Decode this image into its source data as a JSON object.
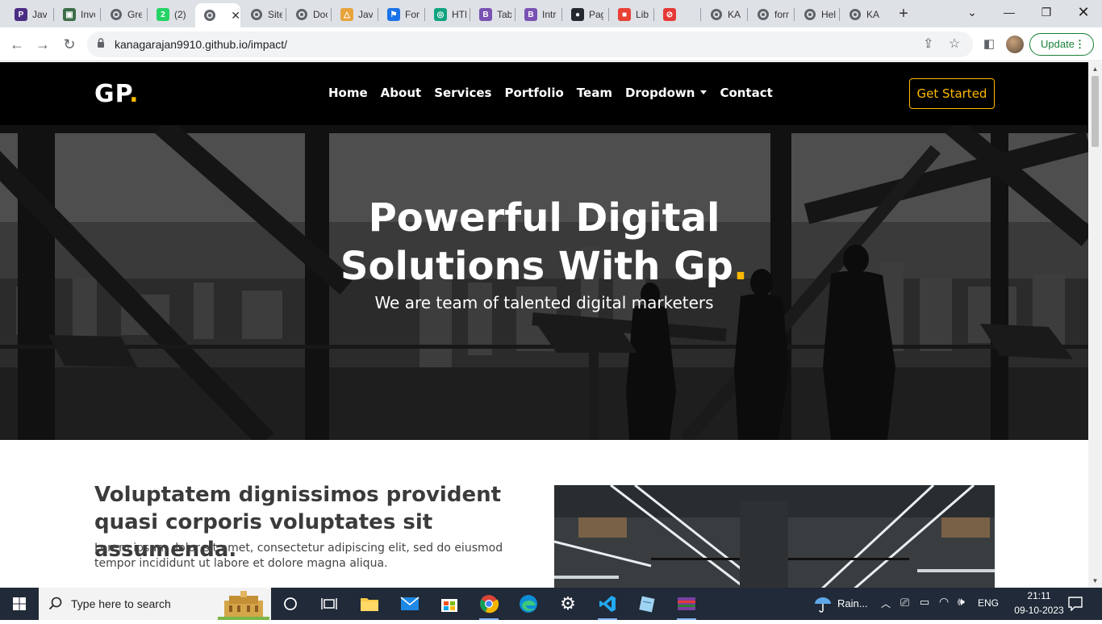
{
  "browser": {
    "tabs": [
      {
        "title": "Java",
        "favicon_color": "#4b2e83",
        "favicon": "P"
      },
      {
        "title": "Invoice",
        "favicon_color": "#3c6e47",
        "favicon": "▣"
      },
      {
        "title": "Great",
        "favicon_color": "#5f6368",
        "favicon": "globe"
      },
      {
        "title": "(2)",
        "favicon_color": "#25d366",
        "favicon": "2"
      },
      {
        "title": "",
        "favicon_color": "#5f6368",
        "favicon": "globe",
        "active": true
      },
      {
        "title": "Site",
        "favicon_color": "#5f6368",
        "favicon": "globe"
      },
      {
        "title": "Doc",
        "favicon_color": "#5f6368",
        "favicon": "globe"
      },
      {
        "title": "Java",
        "favicon_color": "#e8a33d",
        "favicon": "△"
      },
      {
        "title": "For",
        "favicon_color": "#1a73e8",
        "favicon": "⚑"
      },
      {
        "title": "HTML",
        "favicon_color": "#10a37f",
        "favicon": "◎"
      },
      {
        "title": "Tab",
        "favicon_color": "#7952b3",
        "favicon": "B"
      },
      {
        "title": "Intro",
        "favicon_color": "#7952b3",
        "favicon": "B"
      },
      {
        "title": "Pag",
        "favicon_color": "#24292f",
        "favicon": "●"
      },
      {
        "title": "Lib",
        "favicon_color": "#e94235",
        "favicon": "■"
      },
      {
        "title": "",
        "favicon_color": "#e53935",
        "favicon": "⊘"
      },
      {
        "title": "KA",
        "favicon_color": "#5f6368",
        "favicon": "globe"
      },
      {
        "title": "form",
        "favicon_color": "#5f6368",
        "favicon": "globe"
      },
      {
        "title": "Hel",
        "favicon_color": "#5f6368",
        "favicon": "globe"
      },
      {
        "title": "KA",
        "favicon_color": "#5f6368",
        "favicon": "globe"
      }
    ],
    "new_tab_icon": "plus-icon",
    "url": "kanagarajan9910.github.io/impact/",
    "update_label": "Update"
  },
  "site": {
    "logo_text": "GP",
    "logo_dot": ".",
    "nav": [
      {
        "label": "Home"
      },
      {
        "label": "About"
      },
      {
        "label": "Services"
      },
      {
        "label": "Portfolio"
      },
      {
        "label": "Team"
      },
      {
        "label": "Dropdown",
        "has_caret": true
      },
      {
        "label": "Contact"
      }
    ],
    "cta_label": "Get Started",
    "accent_color": "#feb900",
    "hero": {
      "title_line1": "Powerful Digital",
      "title_line2": "Solutions With Gp",
      "title_dot": ".",
      "subtitle": "We are team of talented digital marketers"
    },
    "about": {
      "heading": "Voluptatem dignissimos provident quasi corporis voluptates sit assumenda.",
      "text": "Lorem ipsum dolor sit amet, consectetur adipiscing elit, sed do eiusmod tempor incididunt ut labore et dolore magna aliqua."
    }
  },
  "taskbar": {
    "search_placeholder": "Type here to search",
    "weather": "Rain...",
    "language": "ENG",
    "time": "21:11",
    "date": "09-10-2023"
  }
}
